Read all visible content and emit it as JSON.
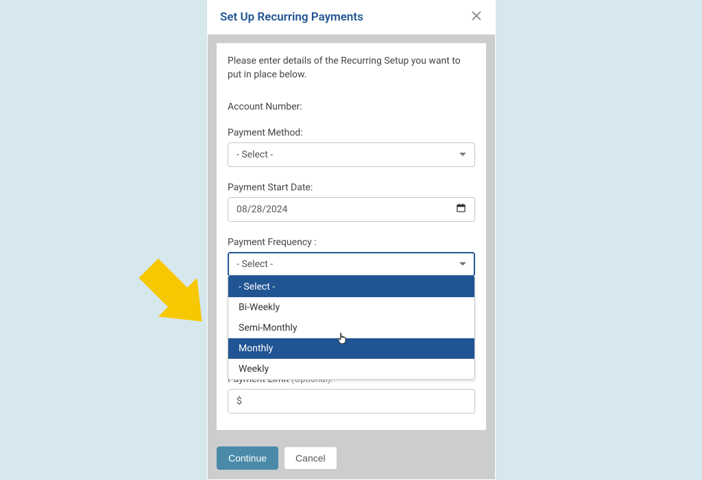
{
  "modal": {
    "title": "Set Up Recurring Payments",
    "instructions": "Please enter details of the Recurring Setup you want to put in place below."
  },
  "fields": {
    "account_number_label": "Account Number:",
    "payment_method_label": "Payment Method:",
    "payment_method_value": "- Select -",
    "payment_start_date_label": "Payment Start Date:",
    "payment_start_date_value": "08/28/2024",
    "payment_frequency_label": "Payment Frequency :",
    "payment_frequency_value": "- Select -",
    "payment_limit_label": "Payment Limit",
    "payment_limit_optional": " (Optional):",
    "payment_limit_value": "$"
  },
  "frequency_options": {
    "opt0": "- Select -",
    "opt1": "Bi-Weekly",
    "opt2": "Semi-Monthly",
    "opt3": "Monthly",
    "opt4": "Weekly"
  },
  "buttons": {
    "continue": "Continue",
    "cancel": "Cancel"
  }
}
